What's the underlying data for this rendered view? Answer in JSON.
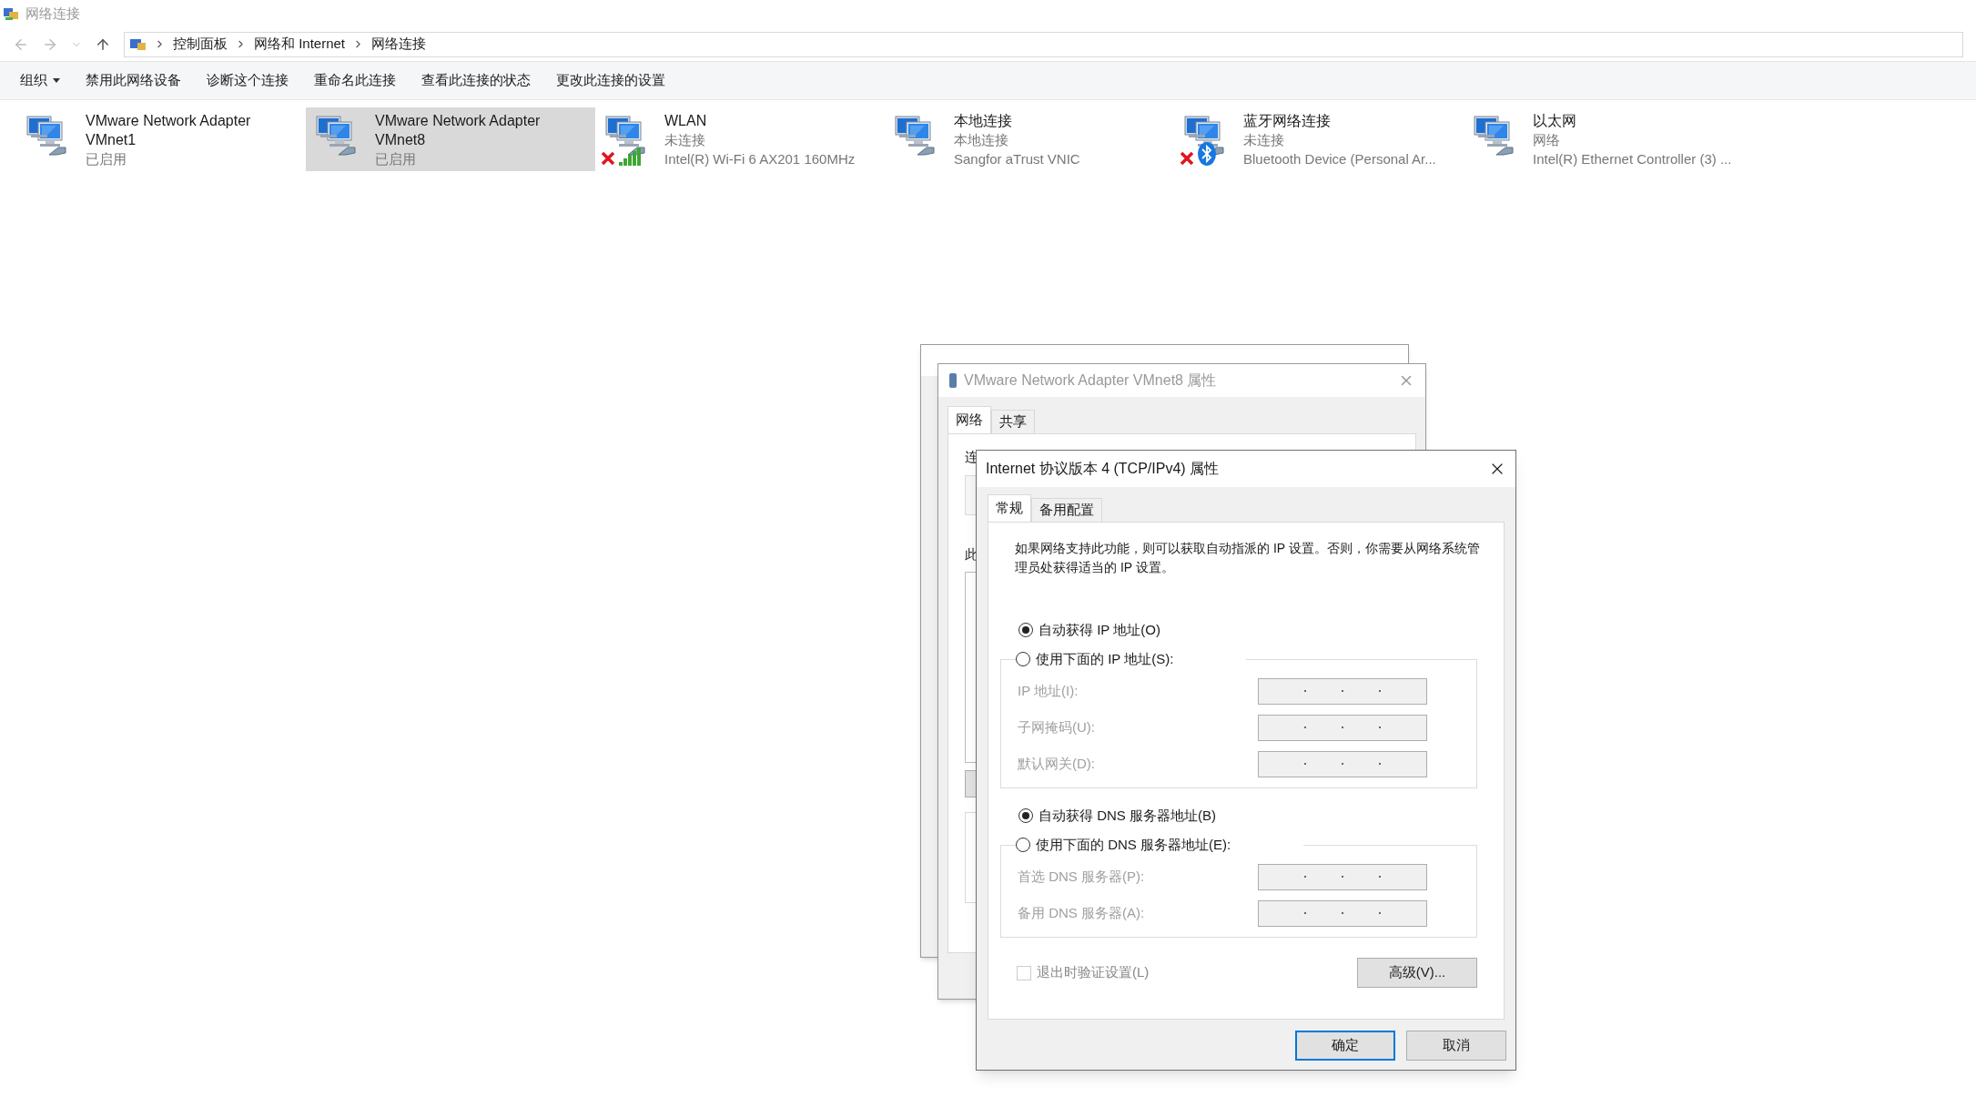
{
  "window": {
    "title": "网络连接"
  },
  "breadcrumb": [
    "控制面板",
    "网络和 Internet",
    "网络连接"
  ],
  "toolbar": [
    {
      "label": "组织",
      "kind": "menu"
    },
    {
      "label": "禁用此网络设备",
      "kind": "button"
    },
    {
      "label": "诊断这个连接",
      "kind": "button"
    },
    {
      "label": "重命名此连接",
      "kind": "button"
    },
    {
      "label": "查看此连接的状态",
      "kind": "button"
    },
    {
      "label": "更改此连接的设置",
      "kind": "button"
    }
  ],
  "adapters": [
    {
      "name": "VMware Network Adapter VMnet1",
      "status": "已启用",
      "kind": "wired",
      "disconnected": false,
      "selected": false
    },
    {
      "name": "VMware Network Adapter VMnet8",
      "status": "已启用",
      "kind": "wired",
      "disconnected": false,
      "selected": true
    },
    {
      "name": "WLAN",
      "status": "未连接",
      "device": "Intel(R) Wi-Fi 6 AX201 160MHz",
      "kind": "wifi",
      "disconnected": true,
      "selected": false
    },
    {
      "name": "本地连接",
      "status": "本地连接",
      "device": "Sangfor aTrust VNIC",
      "kind": "wired",
      "disconnected": false,
      "selected": false
    },
    {
      "name": "蓝牙网络连接",
      "status": "未连接",
      "device": "Bluetooth Device (Personal Ar...",
      "kind": "bluetooth",
      "disconnected": true,
      "selected": false
    },
    {
      "name": "以太网",
      "status": "网络",
      "device": "Intel(R) Ethernet Controller (3) ...",
      "kind": "wired",
      "disconnected": false,
      "selected": false
    }
  ],
  "properties_window": {
    "title": "VMware Network Adapter VMnet8 属性",
    "tabs": [
      {
        "label": "网络",
        "selected": true
      },
      {
        "label": "共享",
        "selected": false
      }
    ],
    "labels": [
      "连",
      "此"
    ]
  },
  "ipv4_dialog": {
    "title": "Internet 协议版本 4 (TCP/IPv4) 属性",
    "tabs": [
      {
        "label": "常规",
        "selected": true
      },
      {
        "label": "备用配置",
        "selected": false
      }
    ],
    "description": "如果网络支持此功能，则可以获取自动指派的 IP 设置。否则，你需要从网络系统管理员处获得适当的 IP 设置。",
    "ip_options": [
      {
        "label": "自动获得 IP 地址(O)",
        "selected": true
      },
      {
        "label": "使用下面的 IP 地址(S):",
        "selected": false
      }
    ],
    "ip_fields": [
      {
        "label": "IP 地址(I):",
        "disabled": true
      },
      {
        "label": "子网掩码(U):",
        "disabled": true
      },
      {
        "label": "默认网关(D):",
        "disabled": true
      }
    ],
    "dns_options": [
      {
        "label": "自动获得 DNS 服务器地址(B)",
        "selected": true
      },
      {
        "label": "使用下面的 DNS 服务器地址(E):",
        "selected": false
      }
    ],
    "dns_fields": [
      {
        "label": "首选 DNS 服务器(P):",
        "disabled": true
      },
      {
        "label": "备用 DNS 服务器(A):",
        "disabled": true
      }
    ],
    "validate_checkbox": {
      "label": "退出时验证设置(L)",
      "checked": false,
      "disabled": true
    },
    "advanced_button": "高级(V)...",
    "buttons": [
      {
        "label": "确定",
        "default": true
      },
      {
        "label": "取消",
        "default": false
      }
    ]
  }
}
